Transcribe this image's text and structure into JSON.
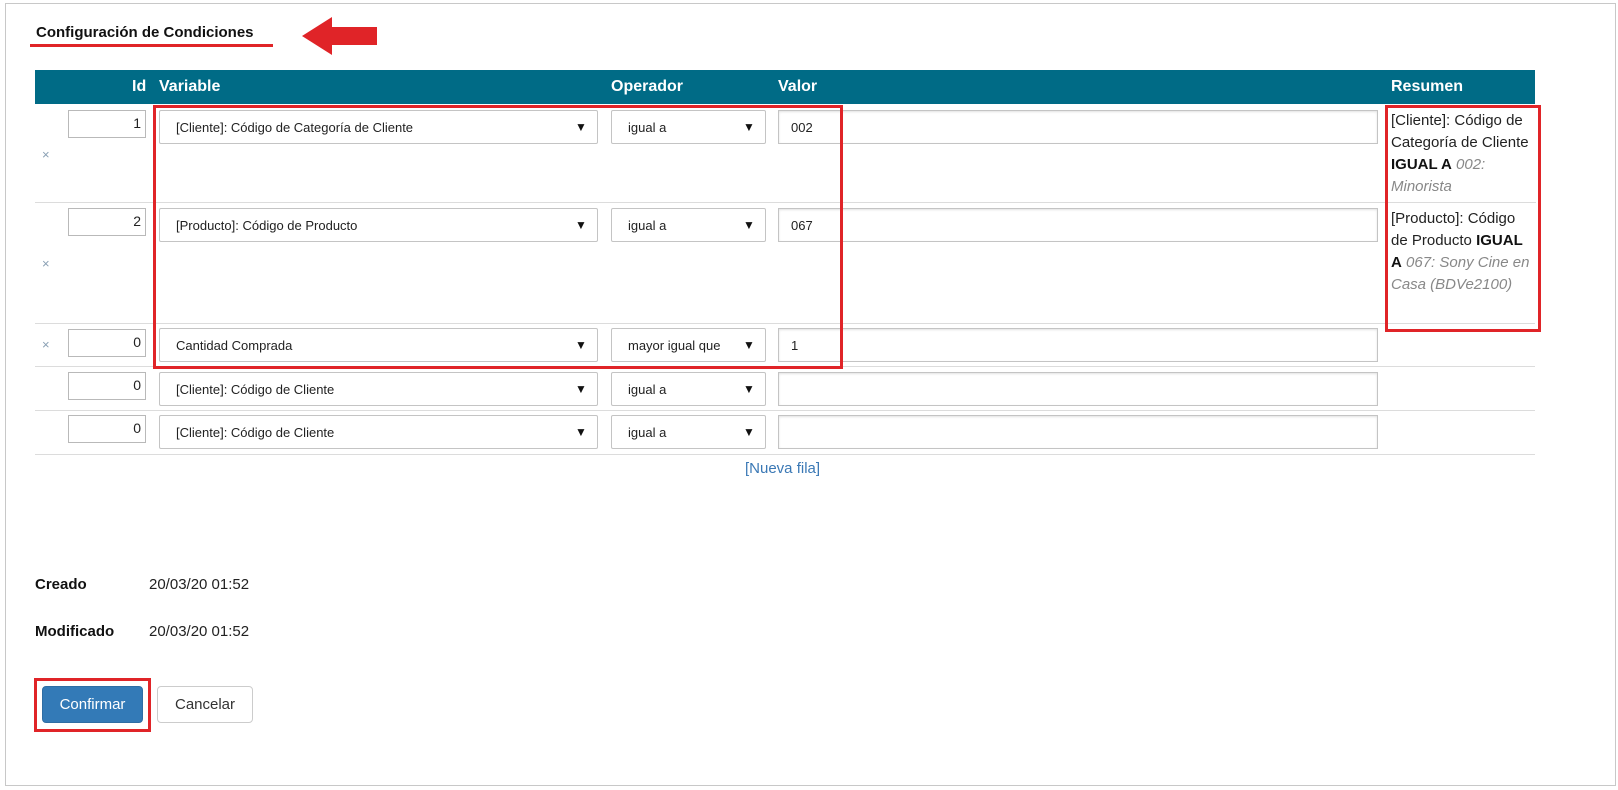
{
  "page_title": "Configuración de Condiciones",
  "table": {
    "headers": {
      "id": "Id",
      "variable": "Variable",
      "operator": "Operador",
      "value": "Valor",
      "summary": "Resumen"
    },
    "rows": [
      {
        "id": "1",
        "variable": "[Cliente]: Código de Categoría de Cliente",
        "operator": "igual a",
        "value": "002",
        "deletable": true
      },
      {
        "id": "2",
        "variable": "[Producto]: Código de Producto",
        "operator": "igual a",
        "value": "067",
        "deletable": true
      },
      {
        "id": "0",
        "variable": "Cantidad Comprada",
        "operator": "mayor igual que",
        "value": "1",
        "deletable": true
      },
      {
        "id": "0",
        "variable": "[Cliente]: Código de Cliente",
        "operator": "igual a",
        "value": "",
        "deletable": false
      },
      {
        "id": "0",
        "variable": "[Cliente]: Código de Cliente",
        "operator": "igual a",
        "value": "",
        "deletable": false
      }
    ],
    "summaries": [
      {
        "text": "[Cliente]: Código de Categoría de Cliente",
        "op": "IGUAL A",
        "detail": "002: Minorista"
      },
      {
        "text": "[Producto]: Código de Producto",
        "op": "IGUAL A",
        "detail": "067: Sony Cine en Casa (BDVe2100)"
      }
    ],
    "delete_glyph": "×",
    "new_row_label": "[Nueva fila]"
  },
  "meta": {
    "created_label": "Creado",
    "created_value": "20/03/20 01:52",
    "modified_label": "Modificado",
    "modified_value": "20/03/20 01:52"
  },
  "buttons": {
    "confirm": "Confirmar",
    "cancel": "Cancelar"
  },
  "colors": {
    "header_bg": "#006b86",
    "accent_red": "#e02428",
    "primary": "#337ab7",
    "link": "#3a78b5"
  },
  "icons": {
    "delete": "close-icon",
    "select_caret": "caret-down-icon",
    "annotation": "arrow-left-icon"
  }
}
